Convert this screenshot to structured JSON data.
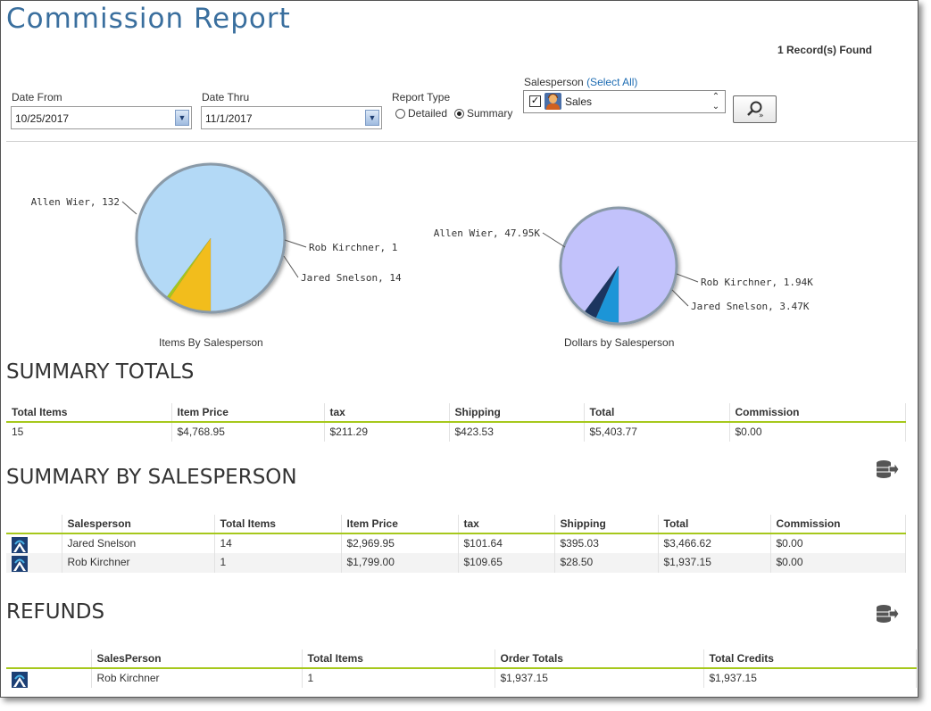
{
  "page": {
    "title": "Commission Report",
    "records_found": "1 Record(s) Found"
  },
  "filters": {
    "date_from": {
      "label": "Date From",
      "value": "10/25/2017"
    },
    "date_thru": {
      "label": "Date Thru",
      "value": "11/1/2017"
    },
    "report_type": {
      "label": "Report Type",
      "options": [
        "Detailed",
        "Summary"
      ],
      "selected": "Summary"
    },
    "salesperson": {
      "label": "Salesperson",
      "select_all": "(Select All)",
      "item": "Sales",
      "checked": true
    }
  },
  "charts": [
    {
      "caption": "Items By Salesperson"
    },
    {
      "caption": "Dollars by Salesperson"
    }
  ],
  "chart_data": [
    {
      "type": "pie",
      "title": "Items By Salesperson",
      "slices": [
        {
          "name": "Allen Wier",
          "value": 132,
          "label": "Allen Wier, 132",
          "color": "#b3d9f6"
        },
        {
          "name": "Rob Kirchner",
          "value": 1,
          "label": "Rob Kirchner, 1",
          "color": "#a6c81c"
        },
        {
          "name": "Jared Snelson",
          "value": 14,
          "label": "Jared Snelson, 14",
          "color": "#f2bd1f"
        }
      ]
    },
    {
      "type": "pie",
      "title": "Dollars by Salesperson",
      "slices": [
        {
          "name": "Allen Wier",
          "value": 47.95,
          "label": "Allen Wier, 47.95K",
          "color": "#c2c2fb"
        },
        {
          "name": "Rob Kirchner",
          "value": 1.94,
          "label": "Rob Kirchner, 1.94K",
          "color": "#1c365f"
        },
        {
          "name": "Jared Snelson",
          "value": 3.47,
          "label": "Jared Snelson, 3.47K",
          "color": "#1f95d7"
        }
      ]
    }
  ],
  "summary_totals": {
    "title": "SUMMARY TOTALS",
    "headers": [
      "Total Items",
      "Item Price",
      "tax",
      "Shipping",
      "Total",
      "Commission"
    ],
    "rows": [
      [
        "15",
        "$4,768.95",
        "$211.29",
        "$423.53",
        "$5,403.77",
        "$0.00"
      ]
    ]
  },
  "summary_by_salesperson": {
    "title": "SUMMARY BY SALESPERSON",
    "headers": [
      "",
      "Salesperson",
      "Total Items",
      "Item Price",
      "tax",
      "Shipping",
      "Total",
      "Commission"
    ],
    "rows": [
      [
        "",
        "Jared Snelson",
        "14",
        "$2,969.95",
        "$101.64",
        "$395.03",
        "$3,466.62",
        "$0.00"
      ],
      [
        "",
        "Rob Kirchner",
        "1",
        "$1,799.00",
        "$109.65",
        "$28.50",
        "$1,937.15",
        "$0.00"
      ]
    ]
  },
  "refunds": {
    "title": "REFUNDS",
    "headers": [
      "",
      "SalesPerson",
      "Total Items",
      "Order Totals",
      "Total Credits"
    ],
    "rows": [
      [
        "",
        "Rob Kirchner",
        "1",
        "$1,937.15",
        "$1,937.15"
      ]
    ]
  },
  "colors": {
    "title_blue": "#3a6f9e",
    "accent_green": "#a6c81c",
    "link_blue": "#1f6db3"
  }
}
